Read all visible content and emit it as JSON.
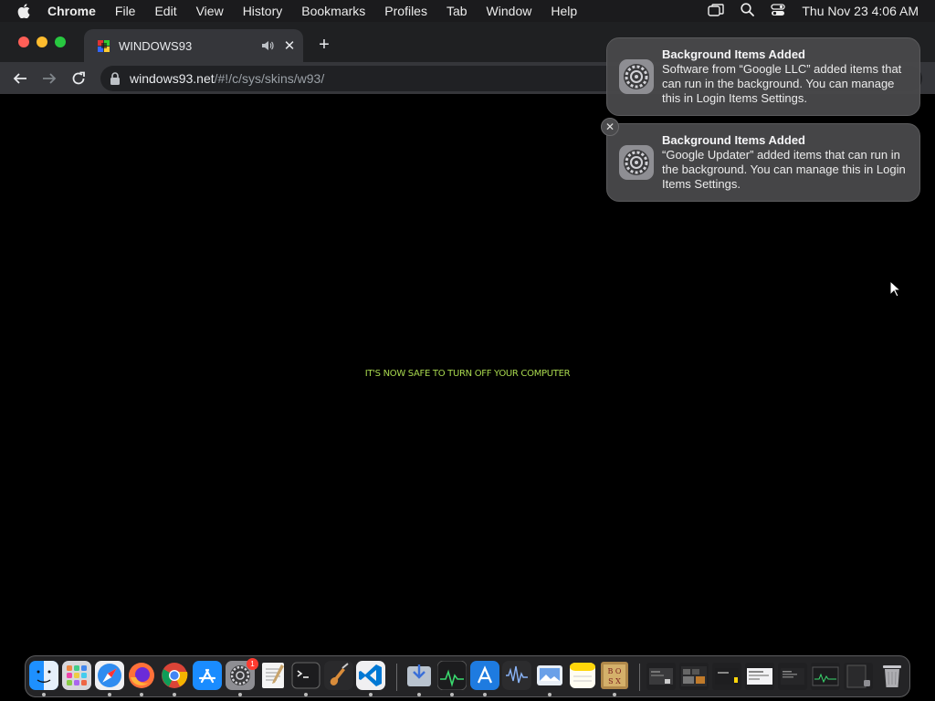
{
  "menubar": {
    "app_name": "Chrome",
    "items": [
      "File",
      "Edit",
      "View",
      "History",
      "Bookmarks",
      "Profiles",
      "Tab",
      "Window",
      "Help"
    ],
    "clock": "Thu Nov 23  4:06 AM"
  },
  "browser": {
    "tab_title": "WINDOWS93",
    "url_host": "windows93.net",
    "url_path": "/#!/c/sys/skins/w93/"
  },
  "page": {
    "message": "IT'S NOW SAFE TO TURN OFF YOUR COMPUTER",
    "message_color": "#a8d84e"
  },
  "notifications": [
    {
      "title": "Background Items Added",
      "body": "Software from “Google LLC” added items that can run in the background. You can manage this in Login Items Settings."
    },
    {
      "title": "Background Items Added",
      "body": "“Google Updater” added items that can run in the background. You can manage this in Login Items Settings."
    }
  ],
  "dock": {
    "apps": [
      "finder-icon",
      "launchpad-icon",
      "safari-icon",
      "firefox-icon",
      "chrome-icon",
      "app-store-icon",
      "system-settings-icon",
      "textedit-icon",
      "terminal-icon",
      "garageband-icon",
      "vscode-icon"
    ],
    "settings_badge": "1",
    "utilities": [
      "downloads-icon",
      "activity-monitor-icon",
      "xcode-icon",
      "audio-icon",
      "preview-icon",
      "notes-icon",
      "dosbox-icon"
    ]
  }
}
